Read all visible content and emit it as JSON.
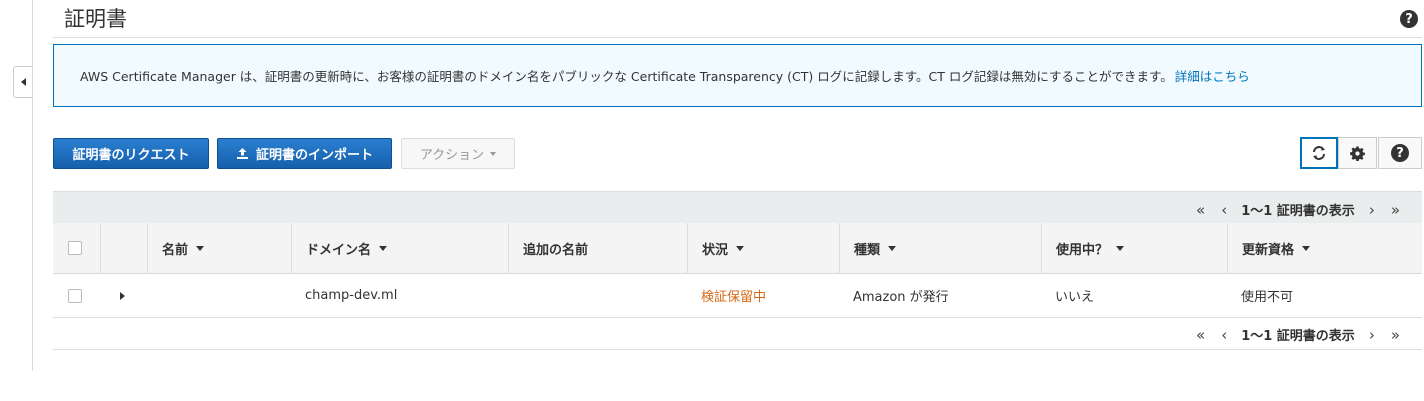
{
  "page": {
    "title": "証明書",
    "help_icon": "question-circle-icon"
  },
  "info_banner": {
    "text": "AWS Certificate Manager は、証明書の更新時に、お客様の証明書のドメイン名をパブリックな Certificate Transparency (CT) ログに記録します。CT ログ記録は無効にすることができます。",
    "link_text": "詳細はこちら"
  },
  "toolbar": {
    "request_label": "証明書のリクエスト",
    "import_label": "証明書のインポート",
    "actions_label": "アクション",
    "refresh_icon": "refresh-icon",
    "settings_icon": "gear-icon",
    "help_icon": "question-circle-icon"
  },
  "pagination": {
    "first": "«",
    "prev": "‹",
    "label": "1〜1 証明書の表示",
    "next": "›",
    "last": "»"
  },
  "table": {
    "columns": [
      "名前",
      "ドメイン名",
      "追加の名前",
      "状況",
      "種類",
      "使用中？",
      "更新資格"
    ],
    "rows": [
      {
        "name": "",
        "domain": "champ-dev.ml",
        "additional_names": "",
        "status": "検証保留中",
        "type": "Amazon が発行",
        "in_use": "いいえ",
        "renewal_eligibility": "使用不可"
      }
    ]
  },
  "colors": {
    "primary_button": "#1b6ec2",
    "info_border": "#0073bb",
    "info_background": "#f1faff",
    "status_pending": "#d86613",
    "link": "#0073bb"
  }
}
